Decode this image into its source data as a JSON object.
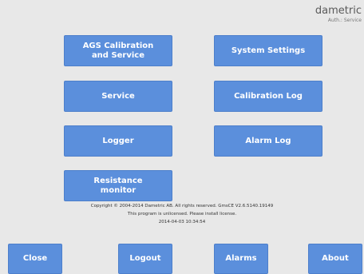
{
  "brand": {
    "name": "dametric",
    "sub": "Auth.: Service"
  },
  "buttons": {
    "ags": "AGS Calibration\nand Service",
    "system_settings": "System Settings",
    "service": "Service",
    "calibration_log": "Calibration Log",
    "logger": "Logger",
    "alarm_log": "Alarm Log",
    "resistance": "Resistance\nmonitor"
  },
  "footer": {
    "copyright": "Copyright © 2004-2014 Dametric AB.  All rights reserved.  GmsCE V2.6.5140.19149",
    "license": "This program is unlicensed. Please install license.",
    "datetime": "2014-04-03 10:34:54"
  },
  "bottom": {
    "close": "Close",
    "logout": "Logout",
    "alarms": "Alarms",
    "about": "About"
  },
  "colors": {
    "background": "#e8e8e8",
    "button": "#5b8fdc",
    "button_text": "#ffffff"
  }
}
